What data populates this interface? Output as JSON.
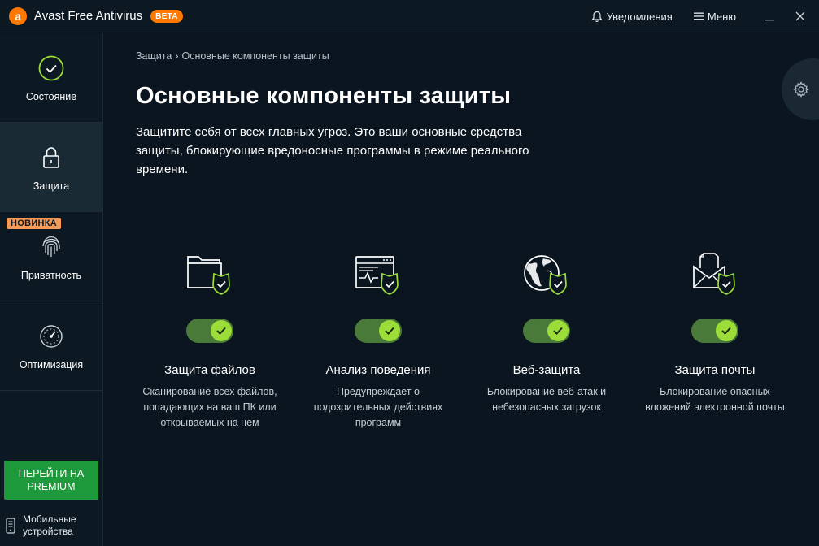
{
  "app": {
    "title": "Avast Free Antivirus",
    "beta": "BETA",
    "logo_letter": "a",
    "notifications": "Уведомления",
    "menu": "Меню"
  },
  "sidebar": {
    "items": [
      {
        "label": "Состояние",
        "icon": "check-circle-icon"
      },
      {
        "label": "Защита",
        "icon": "lock-icon"
      },
      {
        "label": "Приватность",
        "icon": "fingerprint-icon",
        "badge": "НОВИНКА"
      },
      {
        "label": "Оптимизация",
        "icon": "speedometer-icon"
      }
    ],
    "premium_line1": "ПЕРЕЙТИ НА",
    "premium_line2": "PREMIUM",
    "mobile_line1": "Мобильные",
    "mobile_line2": "устройства"
  },
  "breadcrumb": {
    "root": "Защита",
    "separator": "›",
    "current": "Основные компоненты защиты"
  },
  "page": {
    "title": "Основные компоненты защиты",
    "desc_line1": "Защитите себя от всех главных угроз. Это ваши основные средства",
    "desc_line2": "защиты, блокирующие вредоносные программы в режиме реального",
    "desc_line3": "времени."
  },
  "shields": [
    {
      "title": "Защита файлов",
      "desc": "Сканирование всех файлов, попадающих на ваш ПК или открываемых на нем",
      "enabled": true
    },
    {
      "title": "Анализ поведения",
      "desc": "Предупреждает о подозрительных действиях программ",
      "enabled": true
    },
    {
      "title": "Веб-защита",
      "desc": "Блокирование веб-атак и небезопасных загрузок",
      "enabled": true
    },
    {
      "title": "Защита почты",
      "desc": "Блокирование опасных вложений электронной почты",
      "enabled": true
    }
  ],
  "colors": {
    "background": "#0a1520",
    "accent_orange": "#ff7800",
    "accent_green": "#9cdd3a",
    "premium_green": "#1e9a3c"
  }
}
